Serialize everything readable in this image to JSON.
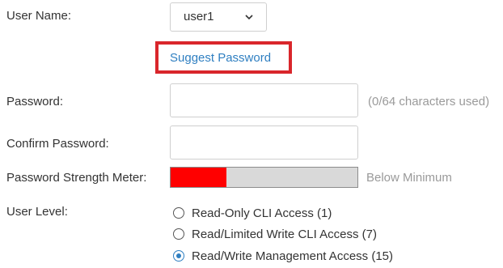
{
  "user_name": {
    "label": "User Name:",
    "selected": "user1"
  },
  "suggest_password": {
    "label": "Suggest Password"
  },
  "password": {
    "label": "Password:",
    "value": "",
    "hint": "(0/64 characters used)"
  },
  "confirm_password": {
    "label": "Confirm Password:",
    "value": ""
  },
  "strength_meter": {
    "label": "Password Strength Meter:",
    "status": "Below Minimum",
    "level_percent": 30,
    "fill_color": "#ff0000"
  },
  "user_level": {
    "label": "User Level:",
    "options": [
      {
        "label": "Read-Only CLI Access (1)",
        "checked": false
      },
      {
        "label": "Read/Limited Write CLI Access (7)",
        "checked": false
      },
      {
        "label": "Read/Write Management Access (15)",
        "checked": true
      }
    ]
  },
  "colors": {
    "link": "#2f7fc1",
    "highlight_border": "#d9262b"
  },
  "icons": {
    "dropdown": "chevron-down-icon"
  }
}
